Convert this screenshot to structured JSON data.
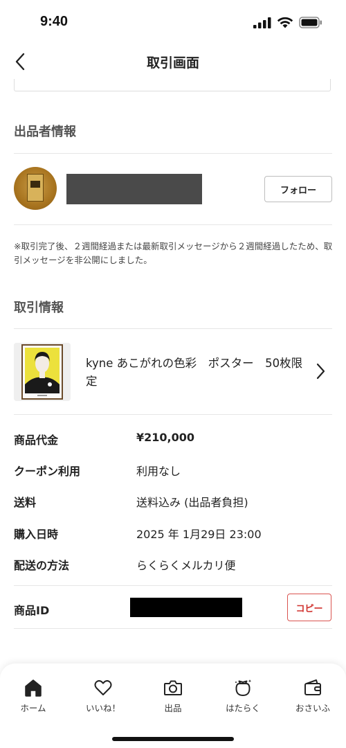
{
  "status_bar": {
    "time": "9:40"
  },
  "nav": {
    "title": "取引画面"
  },
  "seller_section": {
    "title": "出品者情報",
    "follow_label": "フォロー",
    "notice": "※取引完了後、２週間経過または最新取引メッセージから２週間経過したため、取引メッセージを非公開にしました。"
  },
  "transaction_section": {
    "title": "取引情報",
    "item_name": "kyne あこがれの色彩　ポスター　50枚限定",
    "rows": [
      {
        "label": "商品代金",
        "value": "¥210,000"
      },
      {
        "label": "クーポン利用",
        "value": "利用なし"
      },
      {
        "label": "送料",
        "value": "送料込み (出品者負担)"
      },
      {
        "label": "購入日時",
        "value": "2025 年 1月29日 23:00"
      },
      {
        "label": "配送の方法",
        "value": "らくらくメルカリ便"
      }
    ],
    "product_id_label": "商品ID",
    "copy_label": "コピー"
  },
  "tab_bar": {
    "tabs": [
      {
        "label": "ホーム",
        "icon": "home-icon"
      },
      {
        "label": "いいね！",
        "icon": "heart-icon"
      },
      {
        "label": "出品",
        "icon": "camera-icon"
      },
      {
        "label": "はたらく",
        "icon": "work-bag-icon"
      },
      {
        "label": "おさいふ",
        "icon": "wallet-icon"
      }
    ]
  },
  "colors": {
    "accent": "#d0312d",
    "text": "#222222",
    "divider": "#e6e6e6"
  }
}
